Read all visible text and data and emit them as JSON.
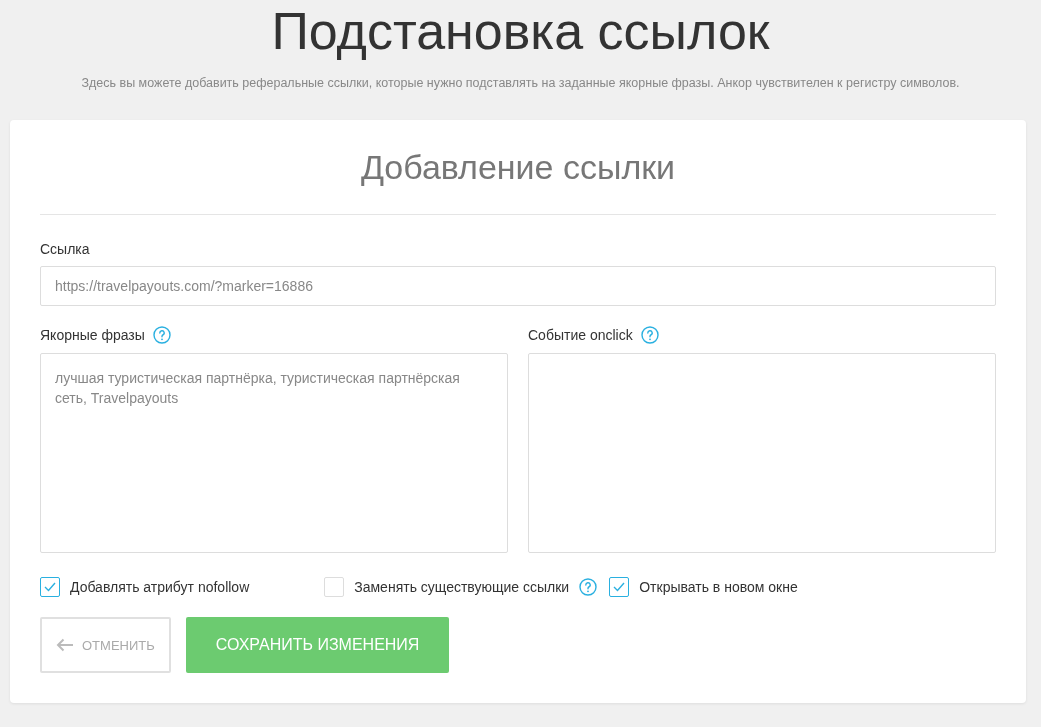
{
  "page": {
    "title": "Подстановка ссылок",
    "description": "Здесь вы можете добавить реферальные ссылки, которые нужно подставлять на заданные якорные фразы. Анкор чувствителен к регистру символов."
  },
  "form": {
    "title": "Добавление ссылки",
    "link": {
      "label": "Ссылка",
      "value": "https://travelpayouts.com/?marker=16886"
    },
    "areas": [
      {
        "label": "Якорные фразы",
        "help": true,
        "value": "лучшая туристическая партнёрка, туристическая партнёрская сеть, Travelpayouts"
      },
      {
        "label": "Событие onclick",
        "help": true
      }
    ],
    "options": [
      {
        "label": "Добавлять атрибут nofollow",
        "checked": true,
        "help": false
      },
      {
        "label": "Заменять существующие ссылки",
        "checked": false,
        "help": true
      },
      {
        "label": "Открывать в новом окне",
        "checked": true,
        "help": false
      }
    ],
    "buttons": [
      {
        "kind": "cancel",
        "label": "ОТМЕНИТЬ"
      },
      {
        "kind": "primary",
        "label": "СОХРАНИТЬ ИЗМЕНЕНИЯ"
      }
    ]
  }
}
